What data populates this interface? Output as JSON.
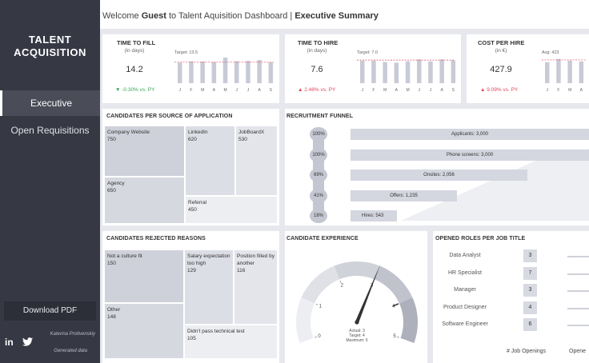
{
  "sidebar": {
    "brand_line1": "TALENT",
    "brand_line2": "ACQUISITION",
    "nav": [
      {
        "label": "Executive",
        "active": true
      },
      {
        "label": "Open Requisitions",
        "active": false
      }
    ],
    "download_label": "Download PDF",
    "author": "Katerina Protivenskiy",
    "generated": "Generated data",
    "linkedin_label": "in"
  },
  "header": {
    "welcome": "Welcome",
    "user": "Guest",
    "middle": "to Talent Aquisition Dashboard |",
    "section": "Executive Summary"
  },
  "kpis": [
    {
      "title": "TIME TO FILL",
      "unit": "(in days)",
      "value": "14.2",
      "delta": "▼ -0.30% vs. PY",
      "delta_color": "#3aa65a",
      "ref_label": "Target: 13.5",
      "ref_value": 13.5,
      "months": [
        "J",
        "F",
        "M",
        "A",
        "M",
        "J",
        "J",
        "A",
        "S"
      ],
      "bars": [
        13.2,
        14.0,
        13.9,
        13.6,
        16.5,
        14.1,
        14.3,
        14.9,
        13.4
      ],
      "ymax": 17
    },
    {
      "title": "TIME TO HIRE",
      "unit": "(in days)",
      "value": "7.6",
      "delta": "▲ 2.48% vs. PY",
      "delta_color": "#e0475b",
      "ref_label": "Target: 7.0",
      "ref_value": 7.0,
      "months": [
        "J",
        "F",
        "M",
        "A",
        "M",
        "J",
        "J",
        "A",
        "S"
      ],
      "bars": [
        6.8,
        6.8,
        6.4,
        6.2,
        6.6,
        7.2,
        6.6,
        7.2,
        6.9
      ],
      "ymax": 8
    },
    {
      "title": "COST PER HIRE",
      "unit": "(in €)",
      "value": "427.9",
      "delta": "▲ 9.09% vs. PY",
      "delta_color": "#e0475b",
      "ref_label": "Avg: 423",
      "ref_value": 423,
      "months": [
        "J",
        "F",
        "M",
        "A"
      ],
      "bars": [
        380,
        440,
        410,
        395
      ],
      "ymax": 480
    }
  ],
  "source": {
    "title": "CANDIDATES PER SOURCE OF APPLICATION",
    "cells": [
      {
        "label": "Company Website",
        "value": "750"
      },
      {
        "label": "LinkedIn",
        "value": "620"
      },
      {
        "label": "JobBoardX",
        "value": "530"
      },
      {
        "label": "Agency",
        "value": "650"
      },
      {
        "label": "Referral",
        "value": "450"
      }
    ]
  },
  "funnel": {
    "title": "RECRUITMENT FUNNEL",
    "rows": [
      {
        "pct": "100%",
        "label": "Applicants: 3,000",
        "value": 3000
      },
      {
        "pct": "100%",
        "label": "Phone screens: 3,000",
        "value": 3000
      },
      {
        "pct": "69%",
        "label": "Onsites: 2,056",
        "value": 2056
      },
      {
        "pct": "41%",
        "label": "Offers: 1,235",
        "value": 1235
      },
      {
        "pct": "18%",
        "label": "Hires: 543",
        "value": 543
      }
    ]
  },
  "rejected": {
    "title": "CANDIDATES REJECTED REASONS",
    "cells": [
      {
        "label": "Not a culture fit",
        "value": "150"
      },
      {
        "label": "Salary expectation too high",
        "value": "129"
      },
      {
        "label": "Position filled by another",
        "value": "116"
      },
      {
        "label": "Other",
        "value": "148"
      },
      {
        "label": "Didn't pass technical test",
        "value": "105"
      }
    ]
  },
  "experience": {
    "title": "CANDIDATE EXPERIENCE",
    "ticks": [
      "0",
      "1",
      "2",
      "3",
      "4",
      "5"
    ],
    "actual_label": "Actual: 3",
    "target_label": "Target: 4",
    "max_label": "Maximum: 5",
    "actual": 3,
    "target": 4,
    "max": 5
  },
  "roles": {
    "title": "OPENED ROLES PER JOB TITLE",
    "items": [
      {
        "name": "Data Analyst",
        "count": "3"
      },
      {
        "name": "HR Specialist",
        "count": "7"
      },
      {
        "name": "Manager",
        "count": "3"
      },
      {
        "name": "Product Designer",
        "count": "4"
      },
      {
        "name": "Software Engineer",
        "count": "6"
      }
    ],
    "footer_left": "# Job Openings",
    "footer_right": "Opene"
  },
  "colors": {
    "sidebar": "#363844",
    "bar": "#c8cad6",
    "ref_line": "#e0475b",
    "positive": "#3aa65a",
    "negative": "#e0475b"
  }
}
